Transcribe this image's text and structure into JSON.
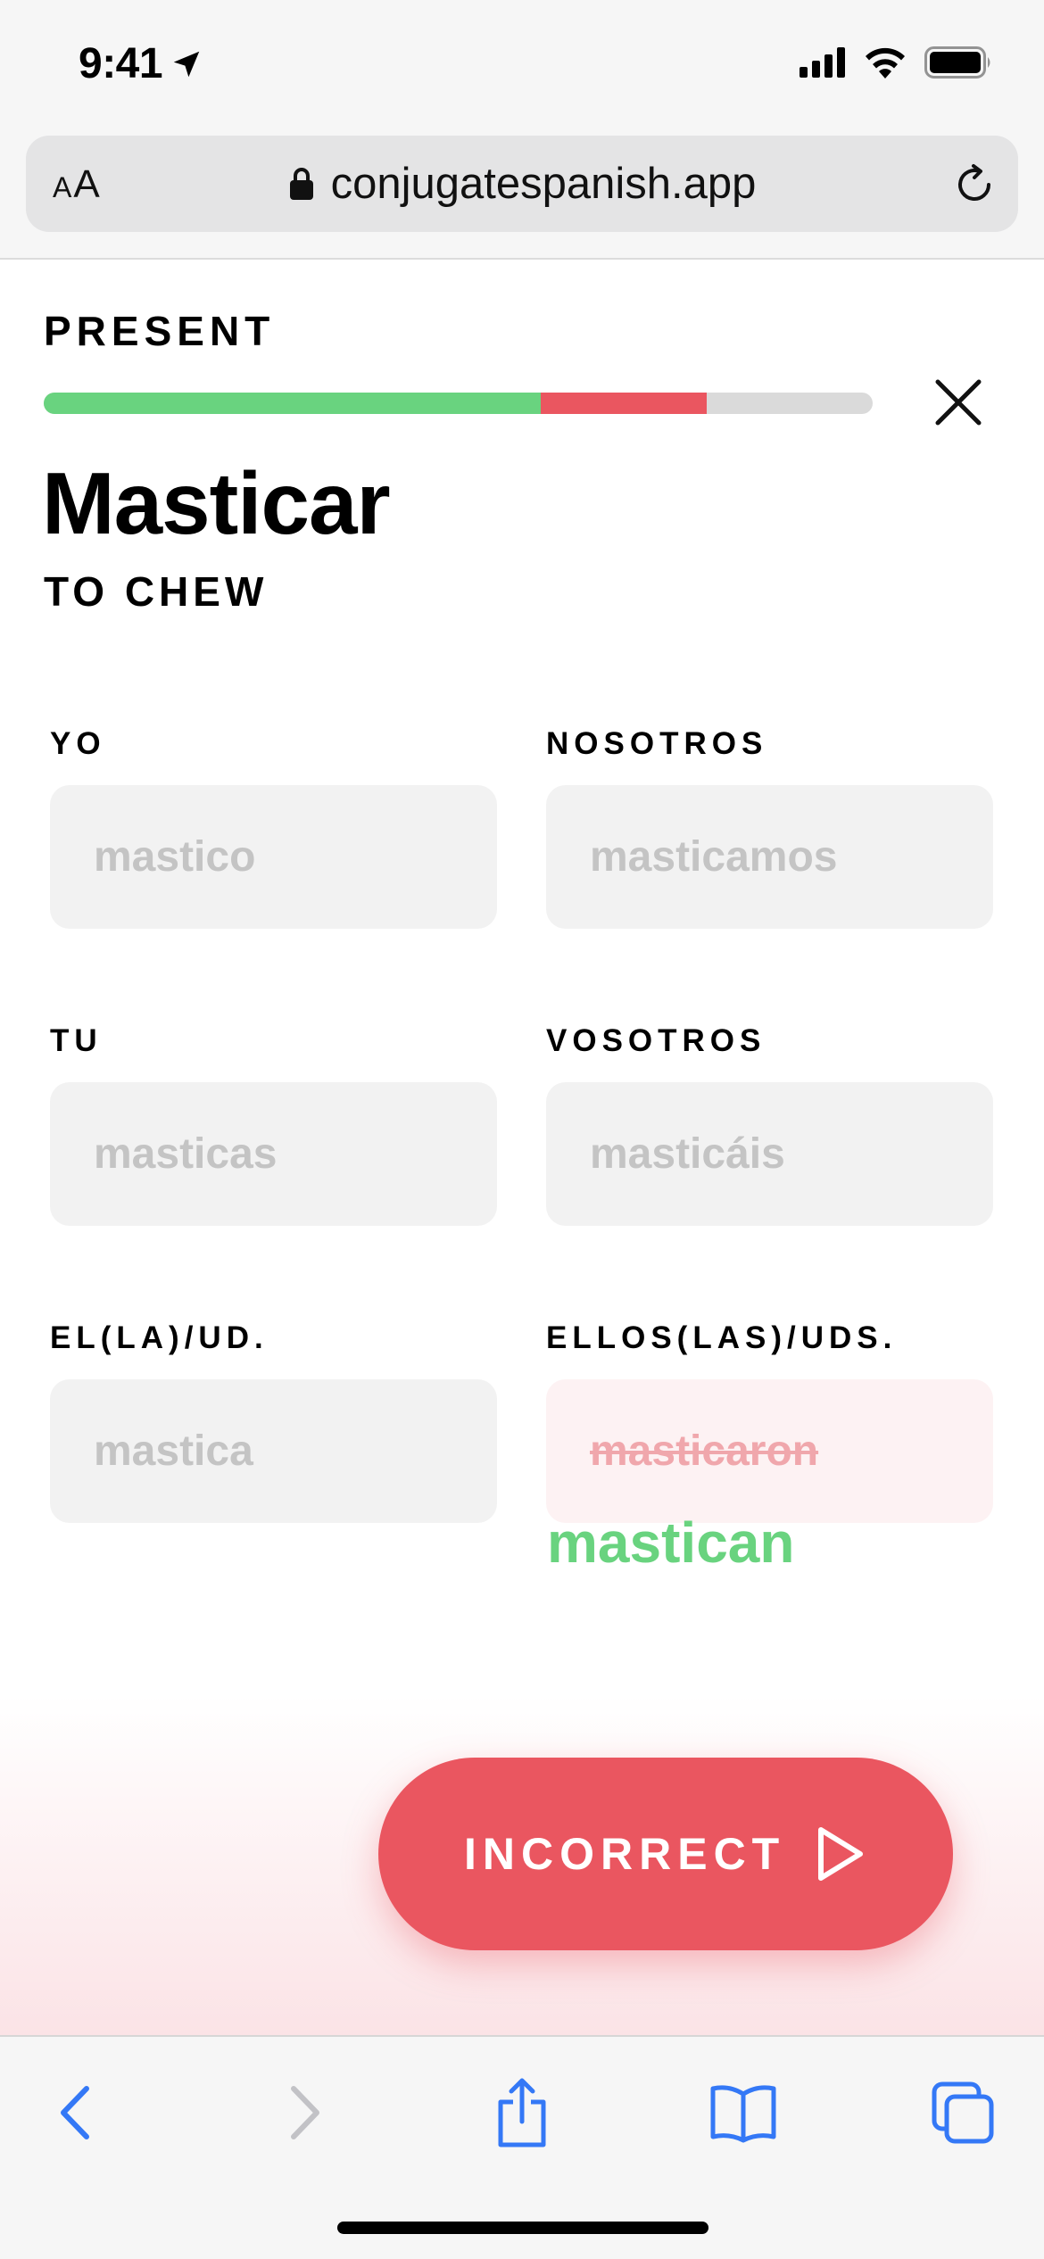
{
  "status_bar": {
    "time": "9:41"
  },
  "browser": {
    "text_size_small": "A",
    "text_size_large": "A",
    "url": "conjugatespanish.app"
  },
  "quiz": {
    "tense": "PRESENT",
    "progress": {
      "correct": 0.6,
      "incorrect": 0.2,
      "remaining": 0.2
    },
    "verb": "Masticar",
    "translation": "TO CHEW",
    "conjugations": [
      {
        "pronoun": "YO",
        "answer": "mastico",
        "status": "correct"
      },
      {
        "pronoun": "NOSOTROS",
        "answer": "masticamos",
        "status": "correct"
      },
      {
        "pronoun": "TU",
        "answer": "masticas",
        "status": "correct"
      },
      {
        "pronoun": "VOSOTROS",
        "answer": "masticáis",
        "status": "correct"
      },
      {
        "pronoun": "EL(LA)/UD.",
        "answer": "mastica",
        "status": "correct"
      },
      {
        "pronoun": "ELLOS(LAS)/UDS.",
        "answer": "masticaron",
        "status": "incorrect",
        "correction": "mastican"
      }
    ],
    "submit_label": "INCORRECT"
  },
  "colors": {
    "correct": "#69d37f",
    "incorrect": "#ea5660",
    "track": "#dadada",
    "ios_blue": "#3478f6"
  },
  "icons": [
    "location-arrow-icon",
    "signal-icon",
    "wifi-icon",
    "battery-icon",
    "lock-icon",
    "reload-icon",
    "close-icon",
    "play-icon",
    "back-icon",
    "forward-icon",
    "share-icon",
    "bookmarks-icon",
    "tabs-icon"
  ]
}
